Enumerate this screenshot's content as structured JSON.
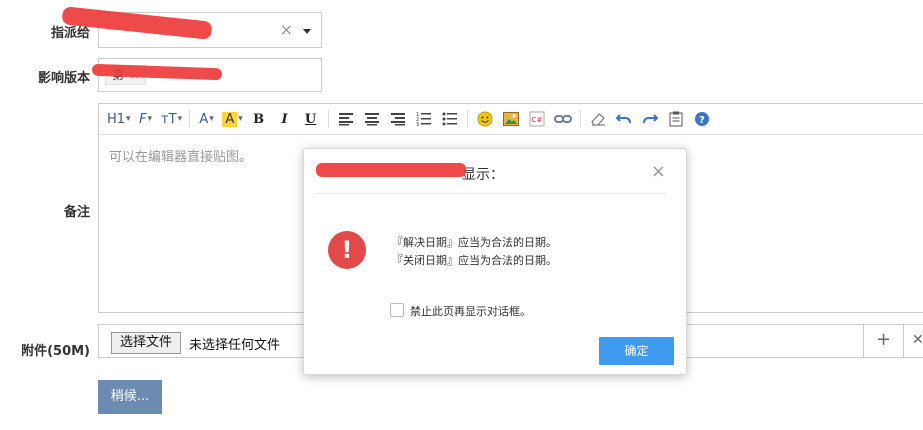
{
  "form": {
    "assign_label": "指派给",
    "version_label": "影响版本",
    "version_tag": "第",
    "version_tag_remove": "×",
    "notes_label": "备注",
    "attach_label": "附件(50M)",
    "submit_label": "稍候..."
  },
  "assign_select": {
    "value": "",
    "clear": "×"
  },
  "editor": {
    "placeholder": "可以在编辑器直接贴图。",
    "toolbar": {
      "heading": "H1",
      "font": "F",
      "size": "тT",
      "color": "A",
      "highlight": "A",
      "bold": "B",
      "italic": "I",
      "underline": "U"
    }
  },
  "file": {
    "button": "选择文件",
    "status": "未选择任何文件",
    "add": "+",
    "remove": "✕"
  },
  "modal": {
    "title": "显示：",
    "close": "×",
    "messages": [
      "『解决日期』应当为合法的日期。",
      "『关闭日期』应当为合法的日期。"
    ],
    "checkbox_label": "禁止此页再显示对话框。",
    "ok_label": "确定",
    "alert_glyph": "!"
  },
  "colors": {
    "accent": "#3f9bf0",
    "submit": "#6b8bb0",
    "alert": "#e24a4a",
    "redaction": "#ee3b3b"
  }
}
